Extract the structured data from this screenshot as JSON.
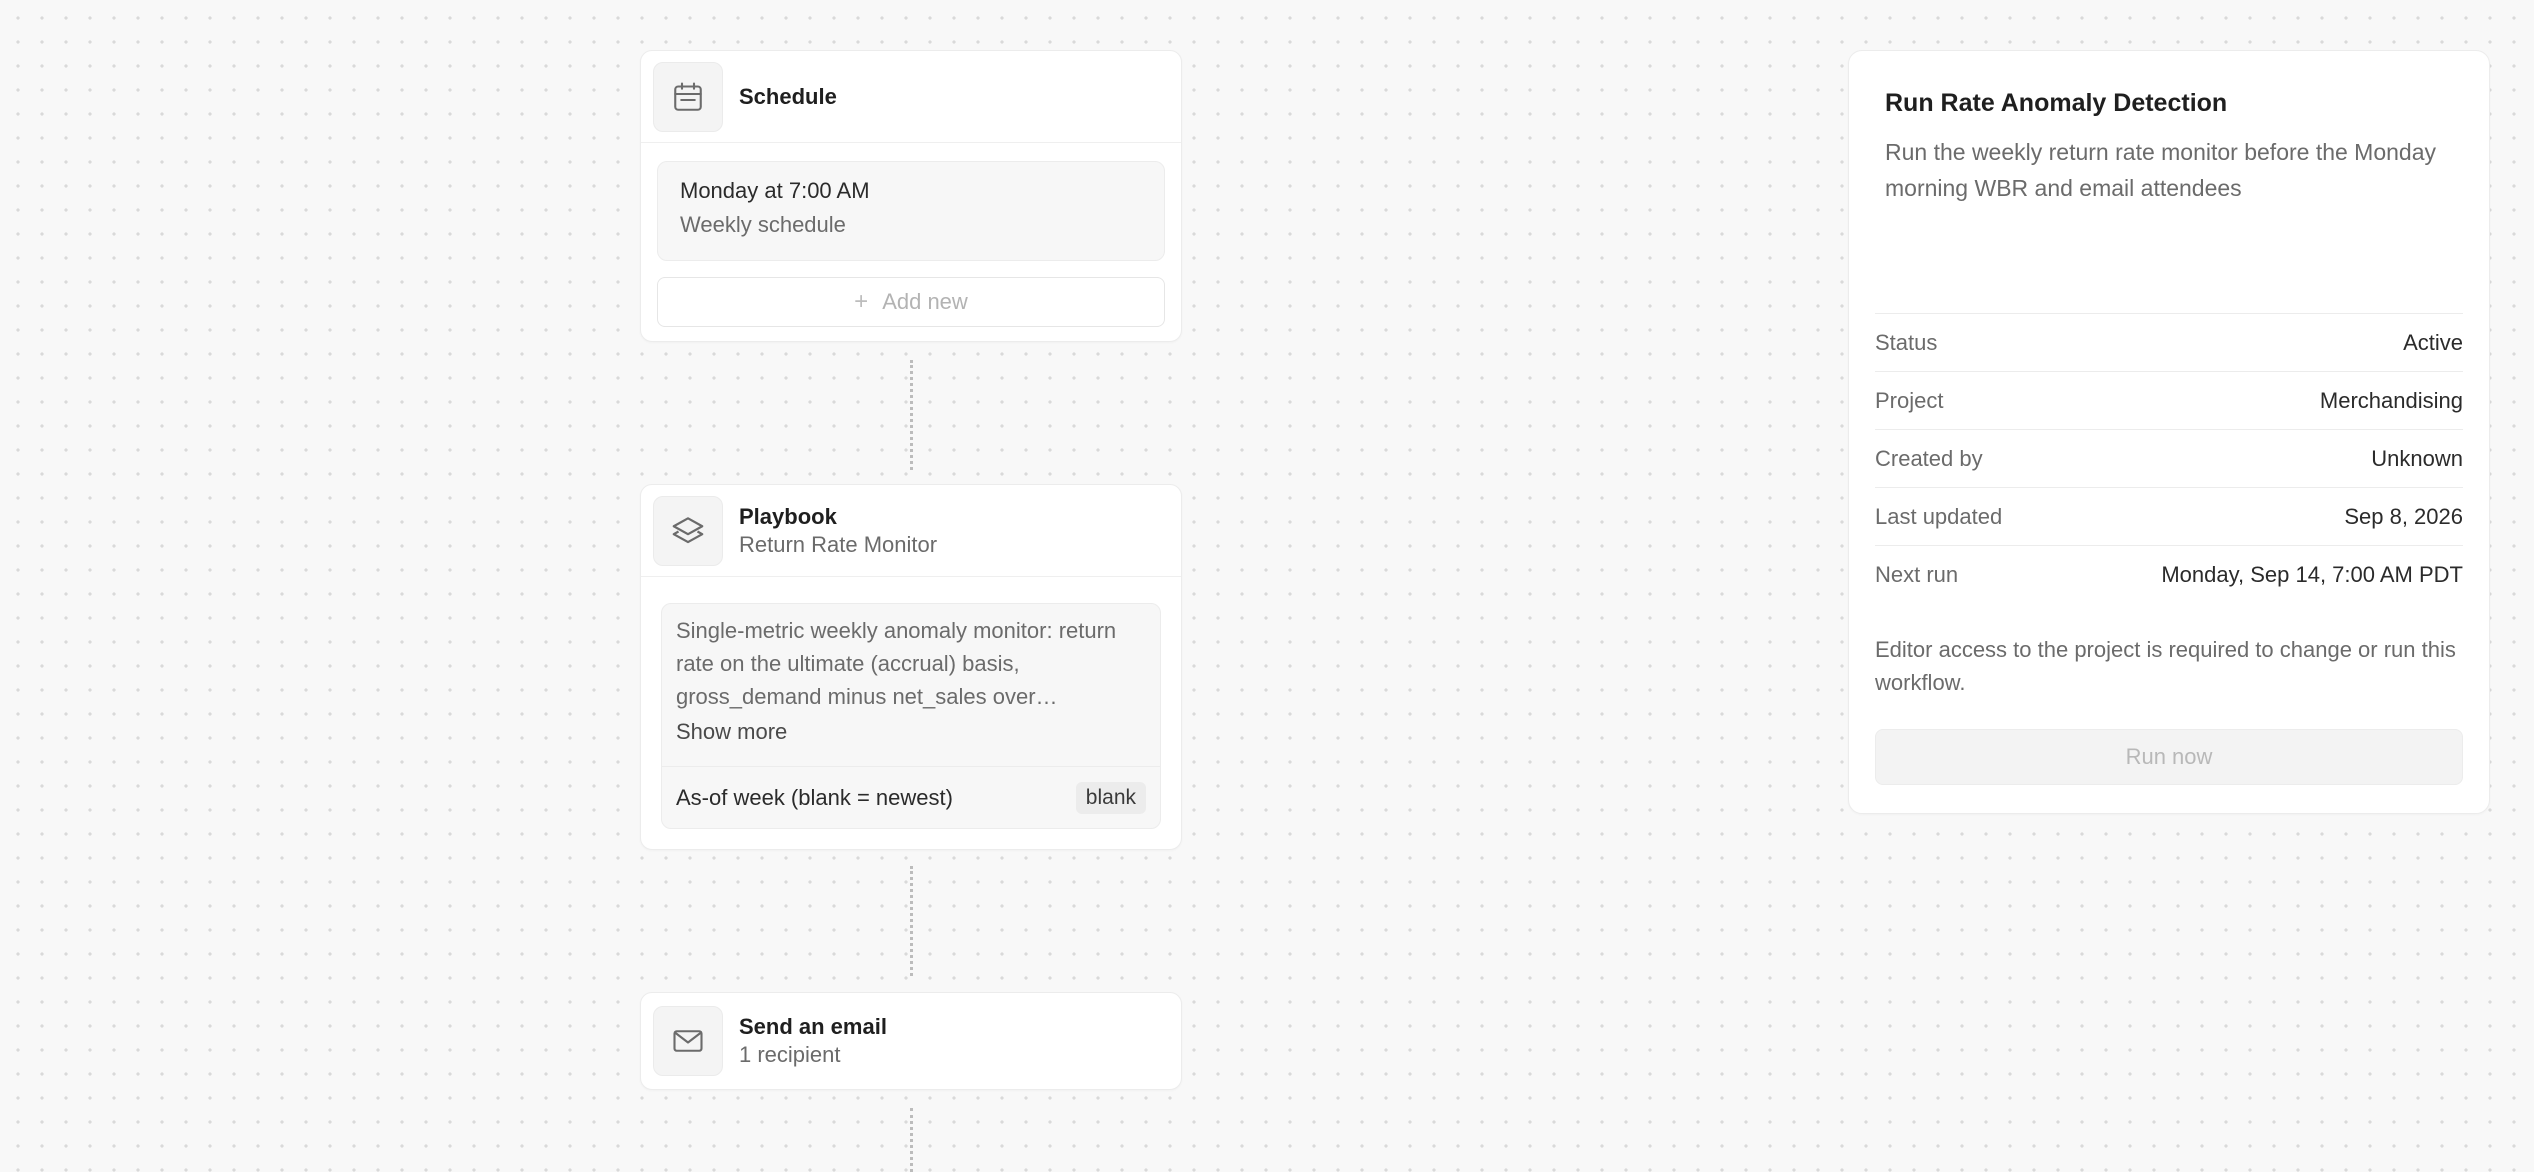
{
  "nodes": {
    "schedule": {
      "title": "Schedule",
      "icon": "calendar-icon",
      "entry_primary": "Monday at 7:00 AM",
      "entry_secondary": "Weekly schedule",
      "add_label": "Add new"
    },
    "playbook": {
      "title": "Playbook",
      "subtitle": "Return Rate Monitor",
      "icon": "layers-icon",
      "description": "Single-metric weekly anomaly monitor: return rate on the ultimate (accrual) basis, gross_demand minus net_sales over…",
      "show_more": "Show more",
      "param_label": "As-of week (blank = newest)",
      "param_value": "blank"
    },
    "email": {
      "title": "Send an email",
      "subtitle": "1 recipient",
      "icon": "mail-icon"
    }
  },
  "panel": {
    "title": "Run Rate Anomaly Detection",
    "description": "Run the weekly return rate monitor before the Monday morning WBR and email attendees",
    "rows": [
      {
        "label": "Status",
        "value": "Active"
      },
      {
        "label": "Project",
        "value": "Merchandising"
      },
      {
        "label": "Created by",
        "value": "Unknown"
      },
      {
        "label": "Last updated",
        "value": "Sep 8, 2026"
      },
      {
        "label": "Next run",
        "value": "Monday, Sep 14, 7:00 AM PDT"
      }
    ],
    "note": "Editor access to the project is required to change or run this workflow.",
    "run_label": "Run now"
  },
  "colors": {
    "background": "#f8f8f8",
    "card": "#ffffff",
    "muted_text": "#6b6b6b",
    "disabled_text": "#b8b8b8"
  }
}
